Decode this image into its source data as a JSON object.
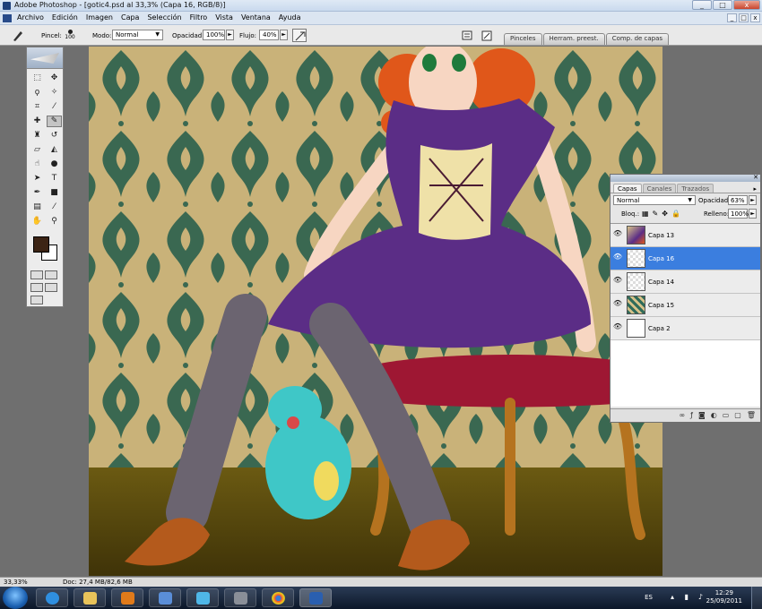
{
  "window": {
    "title": "Adobe Photoshop - [gotic4.psd al 33,3% (Capa 16, RGB/8)]",
    "controls": [
      "_",
      "□",
      "x"
    ]
  },
  "menu": [
    "Archivo",
    "Edición",
    "Imagen",
    "Capa",
    "Selección",
    "Filtro",
    "Vista",
    "Ventana",
    "Ayuda"
  ],
  "options": {
    "brush_label": "Pincel:",
    "brush_size": "100",
    "mode_label": "Modo:",
    "mode_value": "Normal",
    "opacity_label": "Opacidad:",
    "opacity_value": "100%",
    "flow_label": "Flujo:",
    "flow_value": "40%"
  },
  "palette_well": [
    "Pinceles",
    "Herram. preest.",
    "Comp. de capas"
  ],
  "layers_panel": {
    "tabs": [
      "Capas",
      "Canales",
      "Trazados"
    ],
    "blend_mode": "Normal",
    "opacity_label": "Opacidad:",
    "opacity_value": "63%",
    "lock_label": "Bloq.:",
    "fill_label": "Relleno:",
    "fill_value": "100%",
    "layers": [
      {
        "name": "Capa 13",
        "selected": false
      },
      {
        "name": "Capa 16",
        "selected": true
      },
      {
        "name": "Capa 14",
        "selected": false
      },
      {
        "name": "Capa 15",
        "selected": false
      },
      {
        "name": "Capa 2",
        "selected": false
      }
    ]
  },
  "status": {
    "zoom": "33,33%",
    "doc": "Doc: 27,4 MB/82,6 MB"
  },
  "taskbar": {
    "language": "ES",
    "time": "12:29",
    "date": "25/09/2011"
  },
  "colors": {
    "foreground": "#3c2415",
    "background": "#ffffff",
    "selection": "#3b7edf"
  }
}
